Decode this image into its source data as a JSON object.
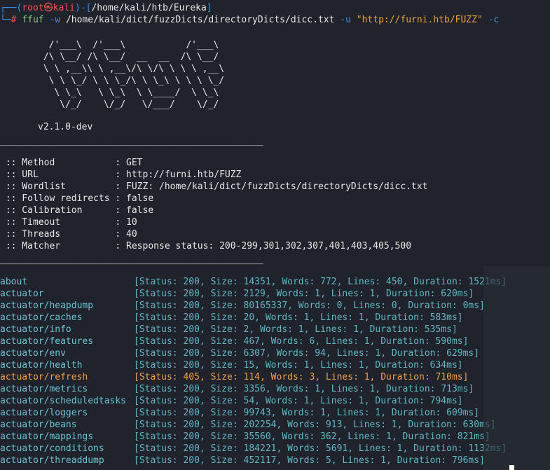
{
  "prompt": {
    "user": "root",
    "skull": "㉿",
    "host": "kali",
    "path": "/home/kali/htb/Eureka"
  },
  "command": {
    "binary": "ffuf",
    "flag_w": "-w",
    "wordlist": "/home/kali/dict/fuzzDicts/directoryDicts/dicc.txt",
    "flag_u": "-u",
    "url": "\"http://furni.htb/FUZZ\"",
    "flag_c": "-c"
  },
  "banner": {
    "ascii": "  /'___\\  /'___\\           /'___\\\n /\\ \\__/ /\\ \\__/  __  __  /\\ \\__/\n \\ \\ ,__\\\\ \\ ,__\\/\\ \\/\\ \\ \\ \\ ,__\\\n  \\ \\ \\_/ \\ \\ \\_/\\ \\ \\_\\ \\ \\ \\ \\_/\n   \\ \\_\\   \\ \\_\\  \\ \\____/  \\ \\_\\\n    \\/_/    \\/_/   \\/___/    \\/_/",
    "version": "v2.1.0-dev"
  },
  "divider": "________________________________________________",
  "config": [
    {
      "key": " :: Method           ",
      "value": ": GET"
    },
    {
      "key": " :: URL              ",
      "value": ": http://furni.htb/FUZZ"
    },
    {
      "key": " :: Wordlist         ",
      "value": ": FUZZ: /home/kali/dict/fuzzDicts/directoryDicts/dicc.txt"
    },
    {
      "key": " :: Follow redirects ",
      "value": ": false"
    },
    {
      "key": " :: Calibration      ",
      "value": ": false"
    },
    {
      "key": " :: Timeout          ",
      "value": ": 10"
    },
    {
      "key": " :: Threads          ",
      "value": ": 40"
    },
    {
      "key": " :: Matcher          ",
      "value": ": Response status: 200-299,301,302,307,401,403,405,500"
    }
  ],
  "results": [
    {
      "name": "about",
      "status": "[Status: 200, Size: 14351, Words: 772, Lines: 450, Duration: 1521ms]",
      "warn": false
    },
    {
      "name": "actuator",
      "status": "[Status: 200, Size: 2129, Words: 1, Lines: 1, Duration: 620ms]",
      "warn": false
    },
    {
      "name": "actuator/heapdump",
      "status": "[Status: 200, Size: 80165337, Words: 0, Lines: 0, Duration: 0ms]",
      "warn": false
    },
    {
      "name": "actuator/caches",
      "status": "[Status: 200, Size: 20, Words: 1, Lines: 1, Duration: 583ms]",
      "warn": false
    },
    {
      "name": "actuator/info",
      "status": "[Status: 200, Size: 2, Words: 1, Lines: 1, Duration: 535ms]",
      "warn": false
    },
    {
      "name": "actuator/features",
      "status": "[Status: 200, Size: 467, Words: 6, Lines: 1, Duration: 590ms]",
      "warn": false
    },
    {
      "name": "actuator/env",
      "status": "[Status: 200, Size: 6307, Words: 94, Lines: 1, Duration: 629ms]",
      "warn": false
    },
    {
      "name": "actuator/health",
      "status": "[Status: 200, Size: 15, Words: 1, Lines: 1, Duration: 634ms]",
      "warn": false
    },
    {
      "name": "actuator/refresh",
      "status": "[Status: 405, Size: 114, Words: 3, Lines: 1, Duration: 710ms]",
      "warn": true
    },
    {
      "name": "actuator/metrics",
      "status": "[Status: 200, Size: 3356, Words: 1, Lines: 1, Duration: 713ms]",
      "warn": false
    },
    {
      "name": "actuator/scheduledtasks",
      "status": "[Status: 200, Size: 54, Words: 1, Lines: 1, Duration: 794ms]",
      "warn": false
    },
    {
      "name": "actuator/loggers",
      "status": "[Status: 200, Size: 99743, Words: 1, Lines: 1, Duration: 609ms]",
      "warn": false
    },
    {
      "name": "actuator/beans",
      "status": "[Status: 200, Size: 202254, Words: 913, Lines: 1, Duration: 630ms]",
      "warn": false
    },
    {
      "name": "actuator/mappings",
      "status": "[Status: 200, Size: 35560, Words: 362, Lines: 1, Duration: 821ms]",
      "warn": false
    },
    {
      "name": "actuator/conditions",
      "status": "[Status: 200, Size: 184221, Words: 5691, Lines: 1, Duration: 1132ms]",
      "warn": false
    },
    {
      "name": "actuator/threaddump",
      "status": "[Status: 200, Size: 452117, Words: 5, Lines: 1, Duration: 796ms]",
      "warn": false
    }
  ],
  "colors": {
    "background": "#20232b",
    "prompt_bracket": "#3b8eea",
    "prompt_user": "#ff4d4d",
    "result_name": "#6cc3d6",
    "warn": "#f0a04b"
  }
}
